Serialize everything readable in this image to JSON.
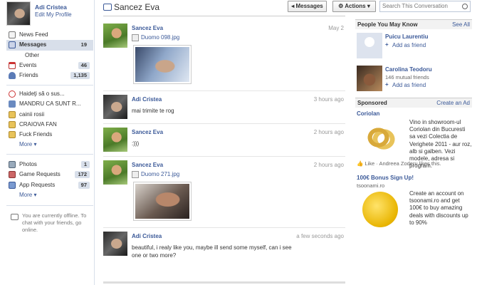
{
  "profile": {
    "name": "Adi Cristea",
    "edit_label": "Edit My Profile"
  },
  "nav": {
    "items": [
      {
        "label": "News Feed",
        "icon": "news-feed-icon",
        "count": ""
      },
      {
        "label": "Messages",
        "icon": "messages-icon",
        "count": "19",
        "selected": true
      },
      {
        "label": "Other",
        "icon": "",
        "count": "",
        "sub": true
      },
      {
        "label": "Events",
        "icon": "events-icon",
        "count": "46"
      },
      {
        "label": "Friends",
        "icon": "friends-icon",
        "count": "1,135"
      }
    ],
    "groups": [
      "Haideţi să o sus...",
      "MANDRU CA SUNT R...",
      "cainii rosii",
      "CRAIOVA FAN",
      "Fuck Friends"
    ],
    "groups_more": "More",
    "apps": [
      {
        "label": "Photos",
        "count": "1"
      },
      {
        "label": "Game Requests",
        "count": "172"
      },
      {
        "label": "App Requests",
        "count": "97"
      }
    ],
    "apps_more": "More",
    "offline_text": "You are currently offline. To chat with your friends, go online."
  },
  "header": {
    "title": "Sancez Eva",
    "messages_button": "◂ Messages",
    "actions_button": "Actions",
    "search_placeholder": "Search This Conversation"
  },
  "messages": [
    {
      "sender": "Sancez Eva",
      "time": "May 2",
      "attachment": "Duomo 098.jpg"
    },
    {
      "sender": "Adi Cristea",
      "time": "3 hours ago",
      "text": "mai trimite te rog"
    },
    {
      "sender": "Sancez Eva",
      "time": "2 hours ago",
      "text": ":)))"
    },
    {
      "sender": "Sancez Eva",
      "time": "2 hours ago",
      "attachment": "Duomo 271.jpg"
    },
    {
      "sender": "Adi Cristea",
      "time": "a few seconds ago",
      "text": "beautiful, i realy like you, maybe ill send some myself, can i see one or two more?"
    }
  ],
  "pymk": {
    "title": "People You May Know",
    "see_all": "See All",
    "people": [
      {
        "name": "Puicu Laurentiu",
        "mutual": "",
        "add": "Add as friend"
      },
      {
        "name": "Carolina Teodoru",
        "mutual": "146 mutual friends",
        "add": "Add as friend"
      }
    ]
  },
  "sponsored": {
    "title": "Sponsored",
    "create_ad": "Create an Ad",
    "ads": [
      {
        "title": "Coriolan",
        "sub": "",
        "text": "Vino in showroom-ul Coriolan din Bucuresti sa vezi Colectia de Verighete 2011 - aur roz, alb si galben. Vezi modele, adresa si program.",
        "like": "Like · Andreea Zoderu likes this."
      },
      {
        "title": "100€ Bonus Sign Up!",
        "sub": "tsoonami.ro",
        "text": "Create an account on tsoonami.ro and get 100€ to buy amazing deals with discounts up to 90%",
        "like": ""
      }
    ]
  }
}
